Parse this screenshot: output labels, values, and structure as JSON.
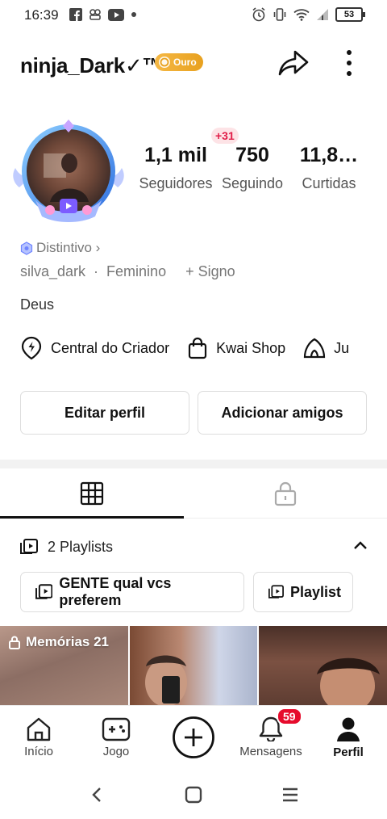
{
  "status_bar": {
    "time": "16:39",
    "battery": "53",
    "left_icons": [
      "facebook-icon",
      "app-icon",
      "youtube-icon",
      "dot-icon"
    ],
    "right_icons": [
      "alarm-icon",
      "vibrate-icon",
      "wifi-icon",
      "signal-icon",
      "battery-icon"
    ]
  },
  "profile": {
    "username": "ninja_Dark✓™",
    "badge_label": "Ouro",
    "badge_color": "#eea92b",
    "stats": [
      {
        "value": "1,1 mil",
        "label": "Seguidores"
      },
      {
        "value": "750",
        "label": "Seguindo"
      },
      {
        "value": "11,8…",
        "label": "Curtidas"
      }
    ],
    "new_followers_badge": "+31",
    "distintivo": "Distintivo ›",
    "handle": "silva_dark",
    "gender": "Feminino",
    "signo": "+ Signo",
    "bio": "Deus"
  },
  "tools": [
    {
      "label": "Central do Criador",
      "icon": "lightning-pin-icon"
    },
    {
      "label": "Kwai Shop",
      "icon": "shopping-bag-icon"
    },
    {
      "label": "Ju",
      "icon": "tent-icon"
    }
  ],
  "buttons": {
    "edit_profile": "Editar perfil",
    "add_friends": "Adicionar amigos"
  },
  "tabs": [
    {
      "name": "grid",
      "icon": "grid-icon",
      "active": true
    },
    {
      "name": "private",
      "icon": "lock-icon",
      "active": false
    }
  ],
  "playlists": {
    "header": "2 Playlists",
    "chips": [
      "GENTE qual vcs preferem",
      "Playlist"
    ]
  },
  "thumbnails": [
    {
      "label": "Memórias 21"
    },
    {
      "label": ""
    },
    {
      "label": ""
    }
  ],
  "bottom_nav": {
    "items": [
      {
        "label": "Início",
        "icon": "home-icon"
      },
      {
        "label": "Jogo",
        "icon": "gamepad-icon"
      },
      {
        "label": "",
        "icon": "plus-circle-icon"
      },
      {
        "label": "Mensagens",
        "icon": "bell-icon"
      },
      {
        "label": "Perfil",
        "icon": "person-icon"
      }
    ],
    "messages_badge": "59",
    "active": "Perfil"
  },
  "system_nav": [
    "back-icon",
    "home-square-icon",
    "recents-icon"
  ]
}
